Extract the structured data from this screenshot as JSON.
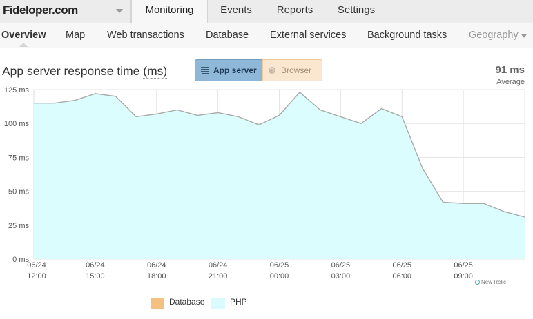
{
  "topnav": {
    "app_name": "Fideloper.com",
    "tabs": [
      {
        "label": "Monitoring",
        "active": true
      },
      {
        "label": "Events"
      },
      {
        "label": "Reports"
      },
      {
        "label": "Settings"
      }
    ]
  },
  "subnav": {
    "tabs": [
      {
        "label": "Overview",
        "active": true
      },
      {
        "label": "Map"
      },
      {
        "label": "Web transactions"
      },
      {
        "label": "Database"
      },
      {
        "label": "External services"
      },
      {
        "label": "Background tasks"
      },
      {
        "label": "Geography",
        "disabled": true
      }
    ]
  },
  "panel": {
    "title_main": "App server response time ",
    "title_unit": "(ms)",
    "toggle": {
      "app_server": "App server",
      "browser": "Browser",
      "app_server_icon": "layers-icon",
      "browser_icon": "globe-icon"
    },
    "average_value": "91 ms",
    "average_label": "Average",
    "credit": "New Relic"
  },
  "colors": {
    "area_fill": "#dcfdfd",
    "line": "#a9a9a9",
    "database": "#f4c183",
    "php": "#d9fbfb",
    "app_server_active": "#8fb7d8",
    "browser_inactive": "#fbe6cf"
  },
  "chart_data": {
    "type": "area",
    "title": "App server response time (ms)",
    "ylim": [
      0,
      125
    ],
    "y_ticks": [
      0,
      25,
      50,
      75,
      100,
      125
    ],
    "y_tick_labels": [
      "0 ms",
      "25 ms",
      "50 ms",
      "75 ms",
      "100 ms",
      "125 ms"
    ],
    "x_hours": [
      0,
      3,
      6,
      9,
      12,
      15,
      18,
      21,
      24
    ],
    "x_tick_labels": [
      [
        "06/24",
        "12:00"
      ],
      [
        "06/24",
        "15:00"
      ],
      [
        "06/24",
        "18:00"
      ],
      [
        "06/24",
        "21:00"
      ],
      [
        "06/25",
        "00:00"
      ],
      [
        "06/25",
        "03:00"
      ],
      [
        "06/25",
        "06:00"
      ],
      [
        "06/25",
        "09:00"
      ]
    ],
    "x_tick_hours": [
      0,
      3,
      6,
      9,
      12,
      15,
      18,
      21
    ],
    "series": [
      {
        "name": "PHP",
        "x_hours": [
          0,
          1,
          2,
          3,
          4,
          5,
          6,
          7,
          8,
          9,
          10,
          11,
          12,
          13,
          14,
          15,
          16,
          17,
          18,
          19,
          20,
          21,
          22,
          23,
          24
        ],
        "values": [
          115,
          115,
          117,
          122,
          120,
          105,
          107,
          110,
          106,
          108,
          105,
          99,
          106,
          123,
          110,
          105,
          100,
          111,
          105,
          67,
          42,
          41,
          41,
          35,
          31
        ]
      }
    ],
    "legend": [
      "Database",
      "PHP"
    ]
  }
}
